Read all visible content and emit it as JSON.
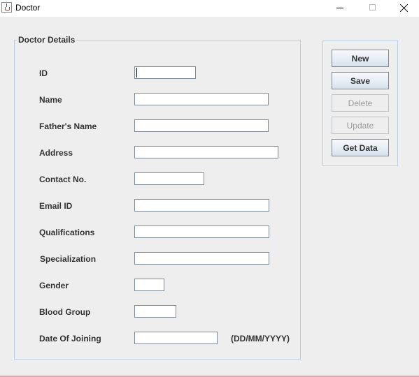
{
  "window": {
    "title": "Doctor",
    "controls": {
      "minimize": "minimize-icon",
      "maximize": "maximize-icon",
      "close": "close-icon"
    }
  },
  "form": {
    "group_title": "Doctor Details",
    "fields": {
      "id": {
        "label": "ID",
        "value": ""
      },
      "name": {
        "label": "Name",
        "value": ""
      },
      "fathers_name": {
        "label": "Father's Name",
        "value": ""
      },
      "address": {
        "label": "Address",
        "value": ""
      },
      "contact_no": {
        "label": "Contact No.",
        "value": ""
      },
      "email_id": {
        "label": "Email ID",
        "value": ""
      },
      "qualifications": {
        "label": "Qualifications",
        "value": ""
      },
      "specialization": {
        "label": "Specialization",
        "value": ""
      },
      "gender": {
        "label": "Gender",
        "value": ""
      },
      "blood_group": {
        "label": "Blood Group",
        "value": ""
      },
      "date_of_joining": {
        "label": "Date Of Joining",
        "value": ""
      }
    },
    "date_hint": "(DD/MM/YYYY)"
  },
  "buttons": {
    "new": {
      "label": "New",
      "enabled": true
    },
    "save": {
      "label": "Save",
      "enabled": true
    },
    "delete": {
      "label": "Delete",
      "enabled": false
    },
    "update": {
      "label": "Update",
      "enabled": false
    },
    "get_data": {
      "label": "Get Data",
      "enabled": true
    }
  }
}
